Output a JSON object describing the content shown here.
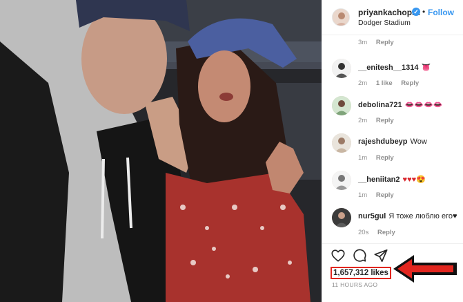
{
  "post": {
    "username": "priyankachopra",
    "verified_mark": "✓",
    "separator": "•",
    "follow_label": "Follow",
    "location": "Dodger Stadium"
  },
  "first_meta": {
    "time": "3m",
    "reply": "Reply"
  },
  "comments": [
    {
      "user": "__enitesh__1314",
      "text": "👅",
      "time": "2m",
      "likes": "1 like",
      "reply": "Reply"
    },
    {
      "user": "debolina721",
      "text": "👄👄👄👄",
      "time": "2m",
      "reply": "Reply"
    },
    {
      "user": "rajeshdubeyp",
      "text": "Wow",
      "time": "1m",
      "reply": "Reply"
    },
    {
      "user": "__heniitan2",
      "text": "♥♥♥😍",
      "time": "1m",
      "reply": "Reply"
    },
    {
      "user": "nur5gul",
      "text": "Я тоже люблю его♥",
      "time": "20s",
      "reply": "Reply"
    }
  ],
  "actions": {
    "like_icon": "heart-icon",
    "comment_icon": "comment-icon",
    "share_icon": "share-icon"
  },
  "likes_label": "1,657,312 likes",
  "time_ago": "11 HOURS AGO",
  "colors": {
    "accent_blue": "#3897f0",
    "highlight_red": "#e2261f",
    "meta_gray": "#8e8e8e"
  }
}
